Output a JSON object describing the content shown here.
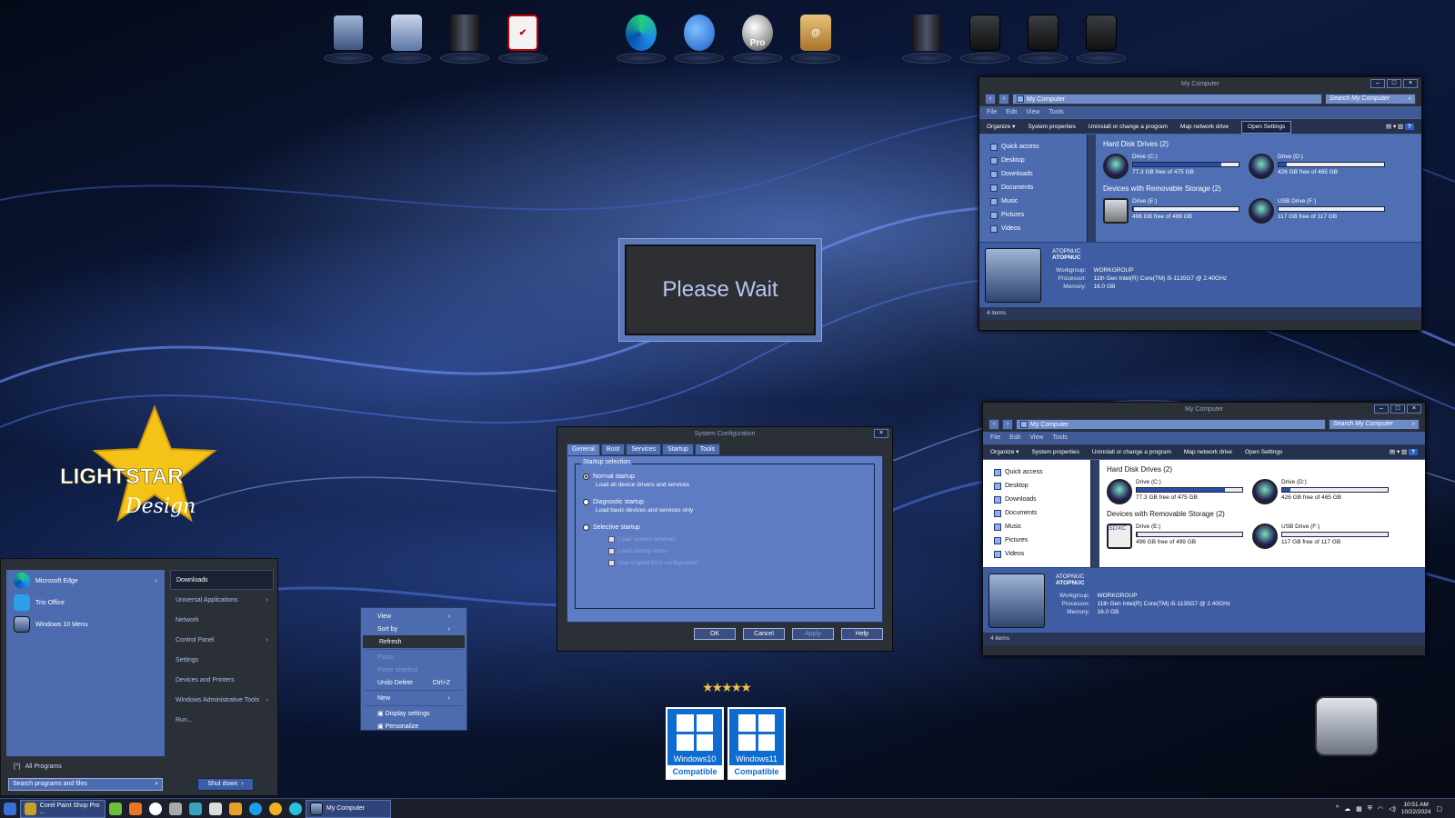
{
  "dock": {
    "icons": [
      "my-computer-icon",
      "user-manager-icon",
      "drive-tower-icon",
      "checklist-icon",
      "edge-icon",
      "thunderbird-icon",
      "pro-sphere-icon",
      "address-book-icon",
      "drive-tower-icon",
      "disk-block-icon",
      "disk-block-icon",
      "disk-block-icon"
    ],
    "pro_label": "Pro"
  },
  "explorer": {
    "title": "My Computer",
    "address": "My Computer",
    "search_placeholder": "Search My Computer",
    "menu": [
      "File",
      "Edit",
      "View",
      "Tools"
    ],
    "toolbar": {
      "organize": "Organize",
      "system": "System properties",
      "uninstall": "Uninstall or change a program",
      "map": "Map network drive",
      "open": "Open Settings"
    },
    "sidebar": [
      "Quick access",
      "Desktop",
      "Downloads",
      "Documents",
      "Music",
      "Pictures",
      "Videos"
    ],
    "group_hdd": "Hard Disk Drives (2)",
    "group_rem": "Devices with Removable Storage (2)",
    "drives": [
      {
        "name": "Drive (C:)",
        "free": "77.3 GB free of 475 GB",
        "used": 0.84
      },
      {
        "name": "Drive (D:)",
        "free": "426 GB free of 465 GB",
        "used": 0.08
      },
      {
        "name": "Drive (E:)",
        "free": "496 GB free of 499 GB",
        "used": 0.01
      },
      {
        "name": "USB Drive (F:)",
        "free": "117 GB free of 117 GB",
        "used": 0.0
      }
    ],
    "sdxc": "SDXC",
    "pc_name": "ATOPNUC",
    "pc_sub": "ATOPNUC",
    "workgroup_k": "Workgroup:",
    "workgroup_v": "WORKGROUP",
    "processor_k": "Processor:",
    "processor_v": "11th Gen Intel(R) Core(TM) i5-1135G7 @ 2.40GHz",
    "memory_k": "Memory:",
    "memory_v": "16.0 GB",
    "items": "4 items"
  },
  "please_wait": "Please Wait",
  "msconfig": {
    "title": "System Configuration",
    "tabs": [
      "General",
      "Boot",
      "Services",
      "Startup",
      "Tools"
    ],
    "group": "Startup selection",
    "normal": "Normal startup",
    "normal_sub": "Load all device drivers and services",
    "diag": "Diagnostic startup",
    "diag_sub": "Load basic devices and services only",
    "selective": "Selective startup",
    "cb1": "Load system services",
    "cb2": "Load startup items",
    "cb3": "Use original boot configuration",
    "ok": "OK",
    "cancel": "Cancel",
    "apply": "Apply",
    "help": "Help"
  },
  "start": {
    "left": [
      "Microsoft Edge",
      "Trio Office",
      "Windows 10 Menu"
    ],
    "right": [
      "Downloads",
      "Universal Applications",
      "Network",
      "Control Panel",
      "Settings",
      "Devices and Printers",
      "Windows Administrative Tools",
      "Run..."
    ],
    "all_programs": "All Programs",
    "search": "Search programs and files",
    "shutdown": "Shut down"
  },
  "context": {
    "view": "View",
    "sort": "Sort by",
    "refresh": "Refresh",
    "paste": "Paste",
    "paste_sc": "Paste shortcut",
    "undo": "Undo Delete",
    "undo_key": "Ctrl+Z",
    "new": "New",
    "display": "Display settings",
    "personalize": "Personalize"
  },
  "logo": {
    "text1": "LIGHTSTAR",
    "text2": "Design"
  },
  "badges": [
    {
      "name": "Windows10",
      "label": "Compatible"
    },
    {
      "name": "Windows11",
      "label": "Compatible"
    }
  ],
  "taskbar": {
    "app1": "Corel Paint Shop Pro ...",
    "app2": "My Computer",
    "time": "10:51 AM",
    "date": "10/22/2024"
  },
  "colors": {
    "accent": "#4d6cb0",
    "dark": "#2b2f36"
  }
}
